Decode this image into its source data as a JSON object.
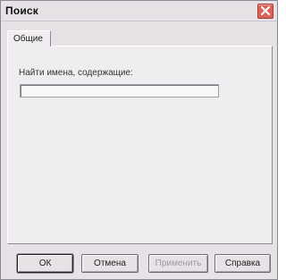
{
  "window": {
    "title": "Поиск"
  },
  "tabs": [
    {
      "label": "Общие"
    }
  ],
  "search": {
    "label": "Найти имена, содержащие:",
    "value": "",
    "placeholder": ""
  },
  "buttons": {
    "ok": "ОК",
    "cancel": "Отмена",
    "apply": "Применить",
    "help": "Справка"
  },
  "colors": {
    "close_button": "#d8645a",
    "window_bg": "#e6e2e6",
    "panel_bg": "#f0edf0"
  },
  "icons": {
    "close": "close-icon"
  }
}
